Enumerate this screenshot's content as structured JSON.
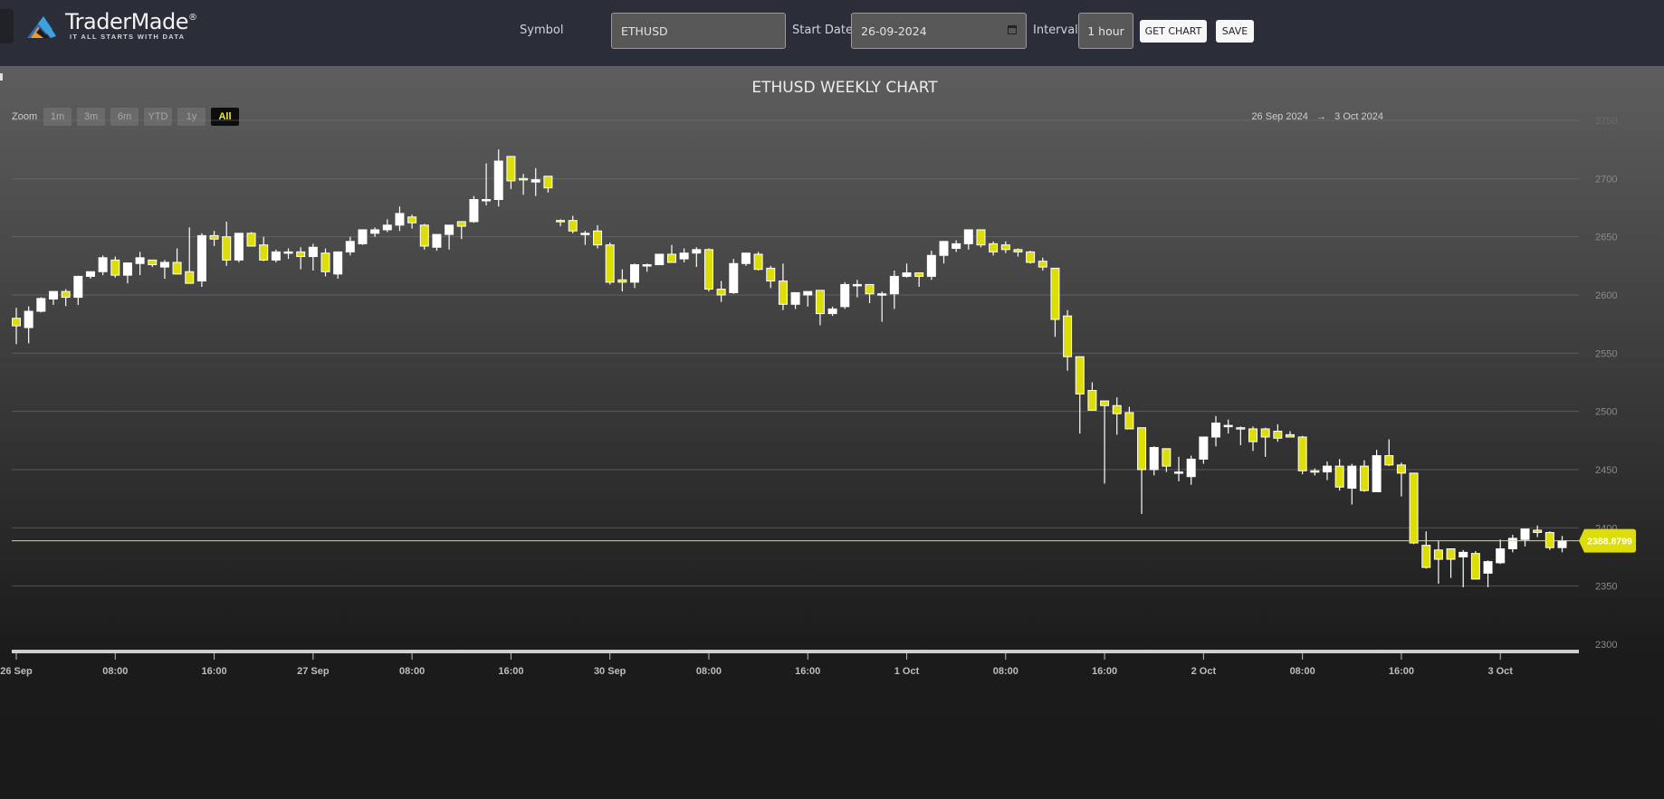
{
  "header": {
    "logo_brand": "TraderMade",
    "logo_registered": "®",
    "logo_tagline": "IT ALL STARTS WITH DATA",
    "symbol_label": "Symbol",
    "symbol_value": "ETHUSD",
    "start_date_label": "Start Date",
    "start_date_value": "26-09-2024",
    "interval_label": "Interval",
    "interval_value": "1 hour",
    "get_chart_label": "GET CHART",
    "save_label": "SAVE"
  },
  "chart_controls": {
    "zoom_label": "Zoom",
    "zoom_buttons": [
      "1m",
      "3m",
      "6m",
      "YTD",
      "1y",
      "All"
    ],
    "active_zoom": "All",
    "range_from": "26 Sep 2024",
    "range_arrow": "→",
    "range_to": "3 Oct 2024"
  },
  "colors": {
    "up_candle": "#ffffff",
    "down_candle": "#dddd0a",
    "price_line": "#e6e60a",
    "price_label_bg": "#dddd0a"
  },
  "chart_data": {
    "type": "candlestick",
    "title": "ETHUSD WEEKLY CHART",
    "xlabel": "",
    "ylabel": "",
    "ylim": [
      2300,
      2750
    ],
    "y_ticks": [
      2300,
      2350,
      2400,
      2450,
      2500,
      2550,
      2600,
      2650,
      2700,
      2750
    ],
    "x_ticks": [
      "26 Sep",
      "08:00",
      "16:00",
      "27 Sep",
      "08:00",
      "16:00",
      "30 Sep",
      "08:00",
      "16:00",
      "1 Oct",
      "08:00",
      "16:00",
      "2 Oct",
      "08:00",
      "16:00",
      "3 Oct"
    ],
    "x_tick_candle_index": [
      0,
      8,
      16,
      24,
      32,
      40,
      48,
      56,
      64,
      72,
      80,
      88,
      96,
      104,
      112,
      120
    ],
    "grid": true,
    "current_price": "2388.8799",
    "current_price_value": 2388.8799,
    "ohlc": [
      [
        2580.0,
        2589.0,
        2557.8,
        2573.5
      ],
      [
        2572.0,
        2590.2,
        2558.5,
        2586.0
      ],
      [
        2586.0,
        2598.0,
        2585.0,
        2597.0
      ],
      [
        2596.5,
        2603.0,
        2591.5,
        2603.0
      ],
      [
        2603.0,
        2605.0,
        2590.5,
        2598.0
      ],
      [
        2598.0,
        2616.5,
        2591.5,
        2616.0
      ],
      [
        2616.0,
        2619.5,
        2614.0,
        2620.0
      ],
      [
        2620.0,
        2634.0,
        2617.0,
        2632.0
      ],
      [
        2630.0,
        2633.0,
        2615.0,
        2617.0
      ],
      [
        2617.0,
        2628.0,
        2610.0,
        2627.5
      ],
      [
        2627.0,
        2637.0,
        2617.0,
        2632.0
      ],
      [
        2630.0,
        2630.0,
        2624.0,
        2626.0
      ],
      [
        2624.0,
        2630.0,
        2614.0,
        2628.0
      ],
      [
        2628.0,
        2640.0,
        2623.0,
        2618.0
      ],
      [
        2620.0,
        2658.0,
        2611.0,
        2610.0
      ],
      [
        2612.0,
        2653.0,
        2607.0,
        2651.0
      ],
      [
        2651.0,
        2655.0,
        2642.0,
        2648.0
      ],
      [
        2650.0,
        2663.0,
        2625.0,
        2630.0
      ],
      [
        2630.0,
        2652.0,
        2628.0,
        2653.0
      ],
      [
        2653.0,
        2654.0,
        2647.0,
        2642.0
      ],
      [
        2643.0,
        2650.0,
        2629.0,
        2630.0
      ],
      [
        2630.0,
        2639.0,
        2628.0,
        2637.0
      ],
      [
        2637.0,
        2640.0,
        2631.0,
        2637.0
      ],
      [
        2637.0,
        2641.0,
        2622.0,
        2633.0
      ],
      [
        2633.0,
        2644.0,
        2621.0,
        2641.0
      ],
      [
        2636.0,
        2640.0,
        2616.0,
        2620.0
      ],
      [
        2618.0,
        2636.0,
        2614.0,
        2637.0
      ],
      [
        2637.0,
        2650.0,
        2634.0,
        2646.0
      ],
      [
        2644.0,
        2650.0,
        2643.0,
        2656.0
      ],
      [
        2653.0,
        2658.0,
        2650.0,
        2656.0
      ],
      [
        2656.0,
        2665.0,
        2654.0,
        2660.0
      ],
      [
        2660.0,
        2676.0,
        2655.0,
        2670.0
      ],
      [
        2667.0,
        2669.0,
        2657.0,
        2662.0
      ],
      [
        2660.0,
        2661.0,
        2639.0,
        2642.0
      ],
      [
        2641.0,
        2652.0,
        2638.0,
        2652.0
      ],
      [
        2652.0,
        2659.0,
        2639.0,
        2660.0
      ],
      [
        2663.0,
        2663.0,
        2648.0,
        2659.0
      ],
      [
        2663.0,
        2685.0,
        2662.0,
        2682.0
      ],
      [
        2681.0,
        2713.0,
        2677.0,
        2682.0
      ],
      [
        2682.0,
        2725.0,
        2676.0,
        2715.0
      ],
      [
        2719.0,
        2713.0,
        2691.0,
        2698.0
      ],
      [
        2700.0,
        2704.0,
        2686.0,
        2699.0
      ],
      [
        2697.0,
        2709.0,
        2685.0,
        2699.0
      ],
      [
        2702.0,
        2698.0,
        2688.0,
        2692.0
      ],
      [
        2664.0,
        2665.0,
        2659.0,
        2663.0
      ],
      [
        2664.0,
        2668.0,
        2653.0,
        2655.0
      ],
      [
        2653.0,
        2655.0,
        2643.0,
        2653.0
      ],
      [
        2655.0,
        2660.0,
        2640.0,
        2643.0
      ],
      [
        2643.0,
        2645.0,
        2609.0,
        2611.0
      ],
      [
        2613.0,
        2622.0,
        2603.0,
        2611.0
      ],
      [
        2611.0,
        2627.0,
        2606.0,
        2626.0
      ],
      [
        2626.0,
        2627.0,
        2620.0,
        2626.0
      ],
      [
        2626.0,
        2635.0,
        2626.0,
        2635.0
      ],
      [
        2635.0,
        2643.0,
        2628.0,
        2628.0
      ],
      [
        2631.0,
        2640.0,
        2628.0,
        2636.0
      ],
      [
        2636.0,
        2641.0,
        2624.0,
        2639.0
      ],
      [
        2639.0,
        2640.0,
        2603.0,
        2605.0
      ],
      [
        2605.0,
        2612.0,
        2594.0,
        2600.0
      ],
      [
        2602.0,
        2631.0,
        2601.0,
        2627.0
      ],
      [
        2627.0,
        2633.0,
        2625.0,
        2636.0
      ],
      [
        2635.0,
        2637.0,
        2621.0,
        2622.0
      ],
      [
        2623.0,
        2625.0,
        2606.0,
        2612.0
      ],
      [
        2612.0,
        2627.0,
        2587.0,
        2592.0
      ],
      [
        2592.0,
        2596.0,
        2588.0,
        2602.0
      ],
      [
        2600.0,
        2603.0,
        2590.0,
        2603.0
      ],
      [
        2604.0,
        2603.0,
        2574.0,
        2584.0
      ],
      [
        2584.0,
        2590.0,
        2582.0,
        2588.0
      ],
      [
        2590.0,
        2611.0,
        2588.0,
        2609.0
      ],
      [
        2608.0,
        2613.0,
        2598.0,
        2609.0
      ],
      [
        2609.0,
        2607.0,
        2593.0,
        2601.0
      ],
      [
        2601.0,
        2603.0,
        2577.0,
        2601.0
      ],
      [
        2601.0,
        2621.0,
        2588.0,
        2616.0
      ],
      [
        2616.0,
        2627.0,
        2615.0,
        2619.0
      ],
      [
        2619.0,
        2617.0,
        2607.0,
        2616.0
      ],
      [
        2616.0,
        2638.0,
        2613.0,
        2634.0
      ],
      [
        2634.0,
        2643.0,
        2627.0,
        2646.0
      ],
      [
        2640.0,
        2647.0,
        2637.0,
        2644.0
      ],
      [
        2644.0,
        2656.0,
        2639.0,
        2656.0
      ],
      [
        2656.0,
        2656.0,
        2641.0,
        2643.0
      ],
      [
        2644.0,
        2646.0,
        2634.0,
        2637.0
      ],
      [
        2643.0,
        2646.0,
        2636.0,
        2639.0
      ],
      [
        2639.0,
        2640.0,
        2633.0,
        2637.0
      ],
      [
        2637.0,
        2638.0,
        2627.0,
        2628.0
      ],
      [
        2629.0,
        2632.0,
        2621.0,
        2624.0
      ],
      [
        2623.0,
        2623.0,
        2564.0,
        2579.0
      ],
      [
        2582.0,
        2587.0,
        2535.0,
        2547.0
      ],
      [
        2547.0,
        2547.0,
        2481.0,
        2515.0
      ],
      [
        2518.0,
        2525.0,
        2501.0,
        2501.0
      ],
      [
        2509.0,
        2502.0,
        2438.0,
        2505.0
      ],
      [
        2505.0,
        2512.0,
        2480.0,
        2498.0
      ],
      [
        2499.0,
        2504.0,
        2488.0,
        2485.0
      ],
      [
        2486.0,
        2486.0,
        2412.0,
        2450.0
      ],
      [
        2450.0,
        2470.0,
        2445.0,
        2469.0
      ],
      [
        2468.0,
        2468.0,
        2448.0,
        2453.0
      ],
      [
        2448.0,
        2461.0,
        2440.0,
        2448.0
      ],
      [
        2444.0,
        2462.0,
        2437.0,
        2459.0
      ],
      [
        2459.0,
        2477.0,
        2455.0,
        2478.0
      ],
      [
        2478.0,
        2496.0,
        2470.0,
        2490.0
      ],
      [
        2488.0,
        2493.0,
        2481.0,
        2488.0
      ],
      [
        2486.0,
        2487.0,
        2471.0,
        2485.0
      ],
      [
        2485.0,
        2487.0,
        2466.0,
        2474.0
      ],
      [
        2485.0,
        2486.0,
        2461.0,
        2478.0
      ],
      [
        2483.0,
        2489.0,
        2474.0,
        2477.0
      ],
      [
        2480.0,
        2483.0,
        2478.0,
        2478.0
      ],
      [
        2478.0,
        2479.0,
        2446.0,
        2449.0
      ],
      [
        2449.0,
        2451.0,
        2445.0,
        2448.0
      ],
      [
        2448.0,
        2457.0,
        2441.0,
        2453.0
      ],
      [
        2453.0,
        2459.0,
        2432.0,
        2435.0
      ],
      [
        2434.0,
        2455.0,
        2420.0,
        2453.0
      ],
      [
        2453.0,
        2458.0,
        2431.0,
        2432.0
      ],
      [
        2431.0,
        2467.0,
        2432.0,
        2462.0
      ],
      [
        2462.0,
        2476.0,
        2453.0,
        2454.0
      ],
      [
        2454.0,
        2456.0,
        2427.0,
        2447.0
      ],
      [
        2447.0,
        2447.0,
        2386.0,
        2387.0
      ],
      [
        2385.0,
        2397.0,
        2365.0,
        2366.0
      ],
      [
        2381.0,
        2389.0,
        2352.0,
        2373.0
      ],
      [
        2382.0,
        2381.0,
        2357.0,
        2373.0
      ],
      [
        2375.0,
        2381.0,
        2349.0,
        2379.0
      ],
      [
        2378.0,
        2380.0,
        2357.0,
        2356.0
      ],
      [
        2361.0,
        2372.0,
        2349.0,
        2371.0
      ],
      [
        2370.0,
        2390.0,
        2369.0,
        2382.0
      ],
      [
        2382.0,
        2394.0,
        2379.0,
        2391.0
      ],
      [
        2390.0,
        2398.0,
        2384.0,
        2399.0
      ],
      [
        2398.0,
        2402.0,
        2392.0,
        2396.0
      ],
      [
        2396.0,
        2397.0,
        2381.0,
        2383.0
      ],
      [
        2383.0,
        2393.0,
        2379.0,
        2389.0
      ]
    ]
  }
}
